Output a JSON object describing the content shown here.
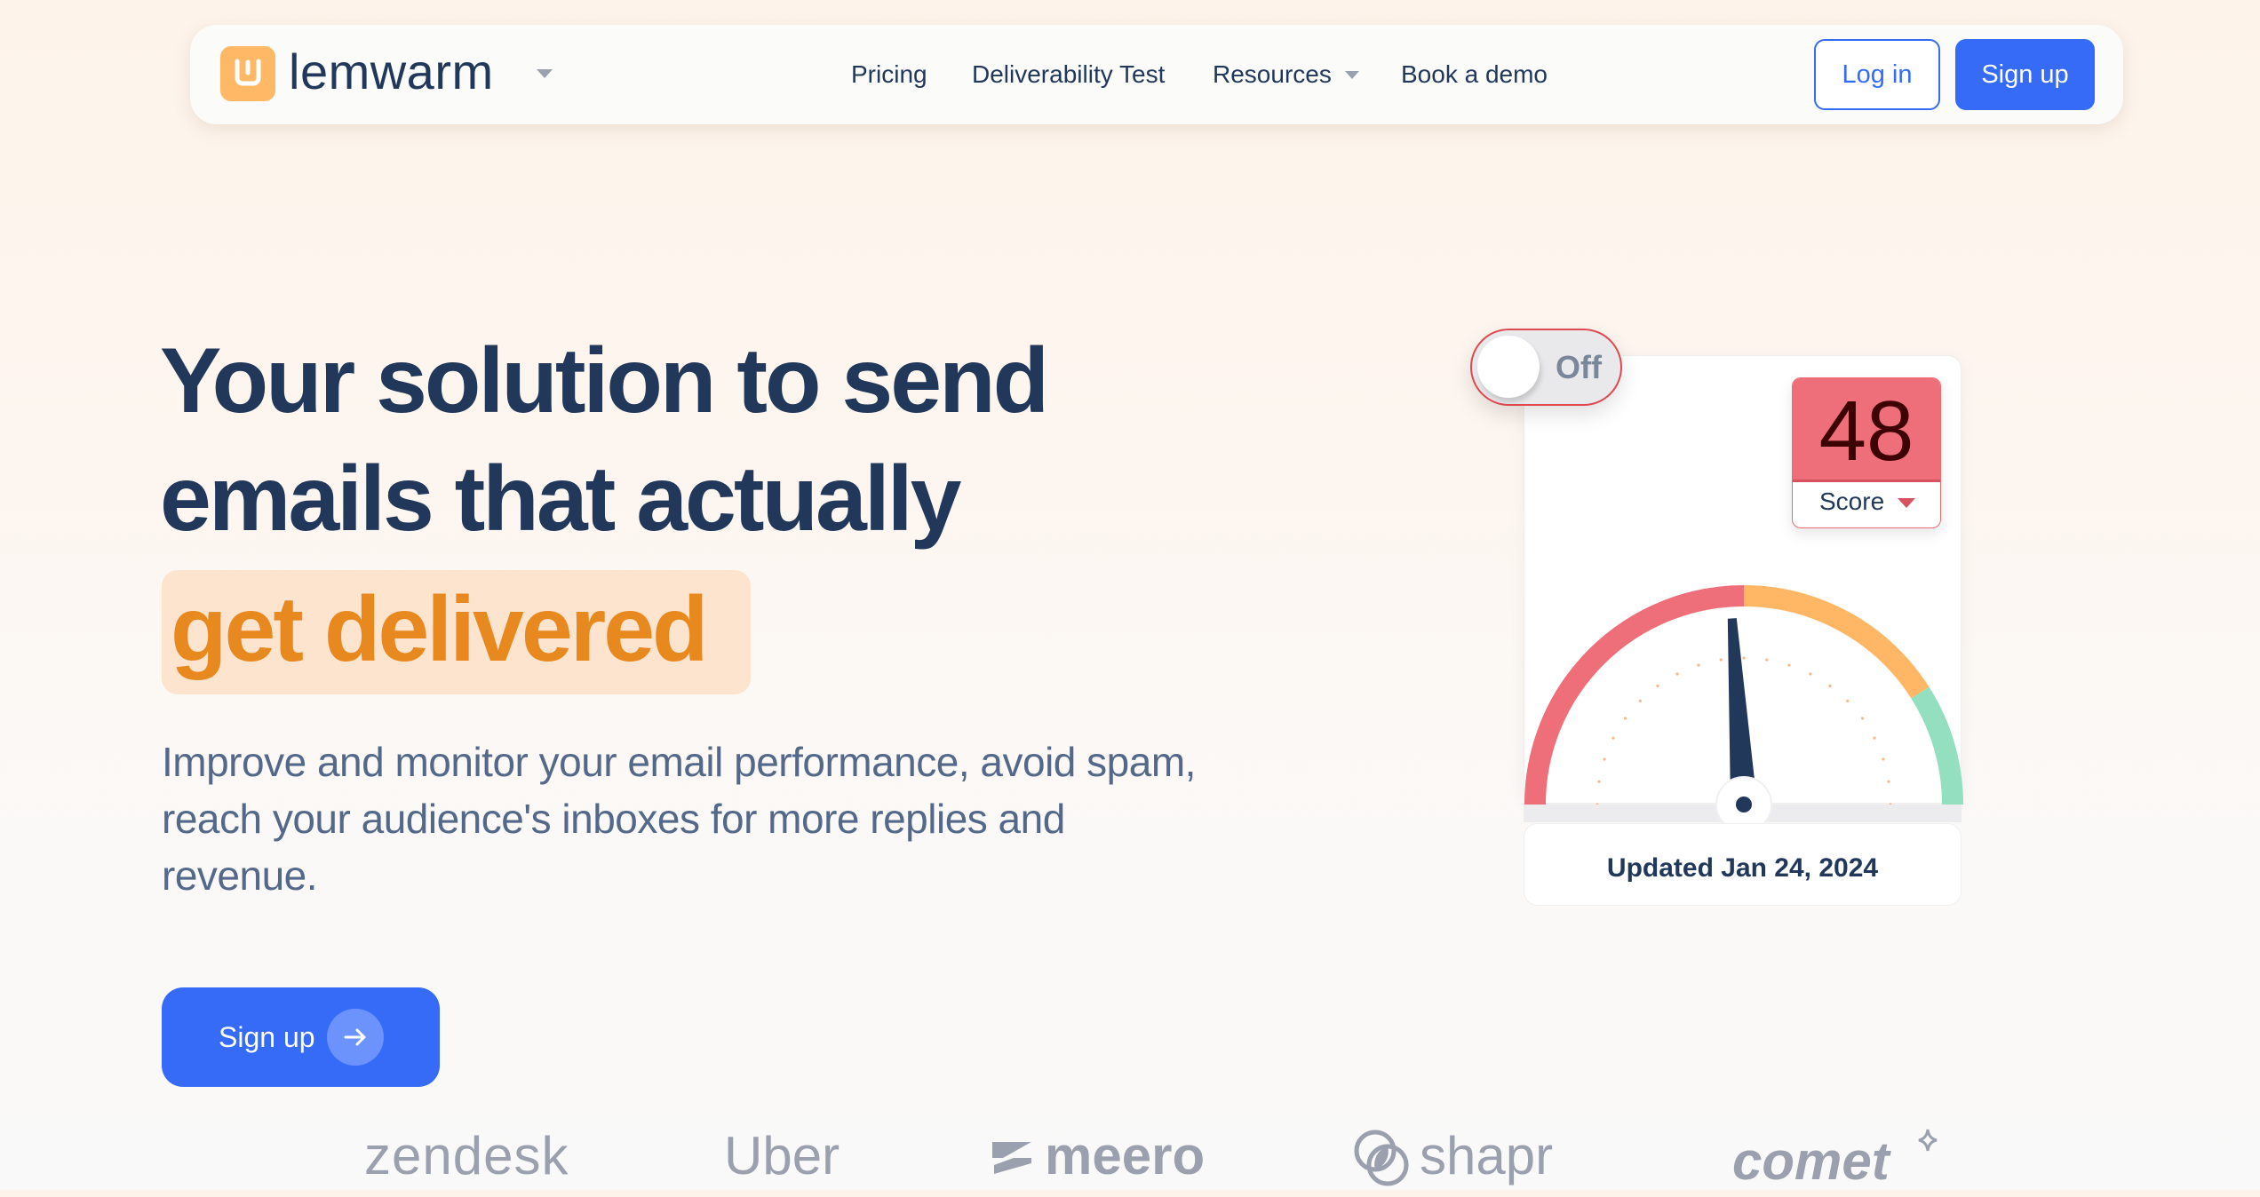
{
  "nav": {
    "brand": "lemwarm",
    "links": [
      {
        "label": "Pricing"
      },
      {
        "label": "Deliverability Test"
      },
      {
        "label": "Resources",
        "has_dropdown": true
      },
      {
        "label": "Book a demo"
      }
    ],
    "login_label": "Log in",
    "signup_label": "Sign up"
  },
  "hero": {
    "headline_line1": "Your solution to send",
    "headline_line2": "emails that actually",
    "headline_highlight": "get delivered",
    "description": "Improve and monitor your email performance, avoid spam, reach your audience's inboxes for more replies and revenue.",
    "cta_label": "Sign up"
  },
  "widget": {
    "toggle_label": "Off",
    "toggle_on": false,
    "score_value": "48",
    "score_label": "Score",
    "updated_text": "Updated Jan 24, 2024",
    "gauge_fraction": 0.48
  },
  "logos": [
    "zendesk",
    "Uber",
    "meero",
    "shapr",
    "comet"
  ],
  "colors": {
    "accent_blue": "#356bf6",
    "brand_orange": "#ffb966",
    "highlight_text": "#e8891f",
    "highlight_bg": "#fde4cf",
    "text_dark": "#22385a",
    "score_red": "#ee6e7a",
    "gauge_orange": "#ffb766",
    "gauge_green": "#93dfc0"
  }
}
